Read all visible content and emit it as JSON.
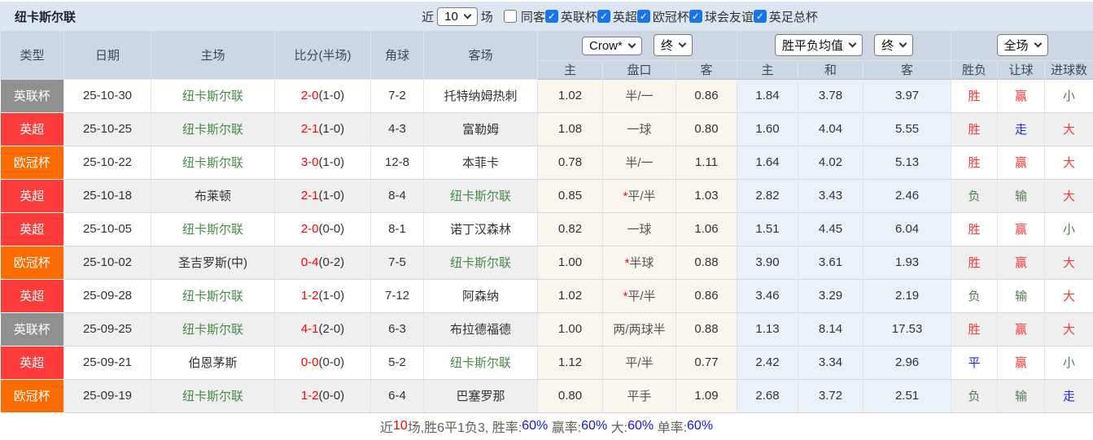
{
  "colors": {
    "bar_bg": "#dce6f0",
    "header_bg": "#cdd7e3",
    "stripe_bg": "#efefef",
    "handicap_col_bg": "#fbf6ed",
    "avg_col_bg": "#e9f2f8",
    "accent_blue_checkbox": "#1a73e8",
    "team_green": "#468c46",
    "score_red": "#ff0000",
    "result_red": "#f03c3c",
    "result_green": "#527d52",
    "result_blue": "#2626e0",
    "league_gray": "#909090",
    "league_red": "#fd3b3b",
    "league_orange": "#fe6c01",
    "summary_blue": "#1414e6",
    "summary_label": "#665e52"
  },
  "filter_bar": {
    "title": "纽卡斯尔联",
    "recent_label": "近",
    "recent_value": "10",
    "games_label": "场",
    "checkboxes": [
      {
        "label": "同客",
        "checked": false
      },
      {
        "label": "英联杯",
        "checked": true
      },
      {
        "label": "英超",
        "checked": true
      },
      {
        "label": "欧冠杯",
        "checked": true
      },
      {
        "label": "球会友谊",
        "checked": true
      },
      {
        "label": "英足总杯",
        "checked": true
      }
    ]
  },
  "table": {
    "main_headers": [
      "类型",
      "日期",
      "主场",
      "比分(半场)",
      "角球",
      "客场"
    ],
    "dropdowns": {
      "handicap_company": "Crow*",
      "handicap_time": "终",
      "odds_avg": "胜平负均值",
      "odds_time": "终",
      "result_scope": "全场"
    },
    "sub_headers": [
      "主",
      "盘口",
      "客",
      "主",
      "和",
      "客",
      "胜负",
      "让球",
      "进球数"
    ],
    "rows": [
      {
        "type": "英联杯",
        "type_color": "gray",
        "date": "25-10-30",
        "home": "纽卡斯尔联",
        "home_highlight": true,
        "score": "2-0",
        "half_score": "(1-0)",
        "corners": "7-2",
        "away": "托特纳姆热刺",
        "away_highlight": false,
        "handicap_home": "1.02",
        "handicap": "半/一",
        "handicap_star": false,
        "handicap_away": "0.86",
        "avg_win": "1.84",
        "avg_draw": "3.78",
        "avg_lose": "3.97",
        "outcome": "胜",
        "outcome_color": "red",
        "handicap_outcome": "赢",
        "handicap_outcome_color": "red",
        "goals_outcome": "小",
        "goals_outcome_color": "green"
      },
      {
        "type": "英超",
        "type_color": "red",
        "date": "25-10-25",
        "home": "纽卡斯尔联",
        "home_highlight": true,
        "score": "2-1",
        "half_score": "(1-0)",
        "corners": "4-3",
        "away": "富勒姆",
        "away_highlight": false,
        "handicap_home": "1.08",
        "handicap": "一球",
        "handicap_star": false,
        "handicap_away": "0.80",
        "avg_win": "1.60",
        "avg_draw": "4.04",
        "avg_lose": "5.55",
        "outcome": "胜",
        "outcome_color": "red",
        "handicap_outcome": "走",
        "handicap_outcome_color": "blue",
        "goals_outcome": "大",
        "goals_outcome_color": "red"
      },
      {
        "type": "欧冠杯",
        "type_color": "orange",
        "date": "25-10-22",
        "home": "纽卡斯尔联",
        "home_highlight": true,
        "score": "3-0",
        "half_score": "(1-0)",
        "corners": "12-8",
        "away": "本菲卡",
        "away_highlight": false,
        "handicap_home": "0.78",
        "handicap": "半/一",
        "handicap_star": false,
        "handicap_away": "1.11",
        "avg_win": "1.64",
        "avg_draw": "4.02",
        "avg_lose": "5.13",
        "outcome": "胜",
        "outcome_color": "red",
        "handicap_outcome": "赢",
        "handicap_outcome_color": "red",
        "goals_outcome": "大",
        "goals_outcome_color": "red"
      },
      {
        "type": "英超",
        "type_color": "red",
        "date": "25-10-18",
        "home": "布莱顿",
        "home_highlight": false,
        "score": "2-1",
        "half_score": "(1-0)",
        "corners": "8-4",
        "away": "纽卡斯尔联",
        "away_highlight": true,
        "handicap_home": "0.85",
        "handicap": "平/半",
        "handicap_star": true,
        "handicap_away": "1.03",
        "avg_win": "2.82",
        "avg_draw": "3.43",
        "avg_lose": "2.46",
        "outcome": "负",
        "outcome_color": "green",
        "handicap_outcome": "输",
        "handicap_outcome_color": "green",
        "goals_outcome": "大",
        "goals_outcome_color": "red"
      },
      {
        "type": "英超",
        "type_color": "red",
        "date": "25-10-05",
        "home": "纽卡斯尔联",
        "home_highlight": true,
        "score": "2-0",
        "half_score": "(0-0)",
        "corners": "8-1",
        "away": "诺丁汉森林",
        "away_highlight": false,
        "handicap_home": "0.82",
        "handicap": "一球",
        "handicap_star": false,
        "handicap_away": "1.06",
        "avg_win": "1.51",
        "avg_draw": "4.45",
        "avg_lose": "6.04",
        "outcome": "胜",
        "outcome_color": "red",
        "handicap_outcome": "赢",
        "handicap_outcome_color": "red",
        "goals_outcome": "小",
        "goals_outcome_color": "green"
      },
      {
        "type": "欧冠杯",
        "type_color": "orange",
        "date": "25-10-02",
        "home": "圣吉罗斯(中)",
        "home_highlight": false,
        "score": "0-4",
        "half_score": "(0-2)",
        "corners": "7-5",
        "away": "纽卡斯尔联",
        "away_highlight": true,
        "handicap_home": "1.00",
        "handicap": "半球",
        "handicap_star": true,
        "handicap_away": "0.88",
        "avg_win": "3.90",
        "avg_draw": "3.61",
        "avg_lose": "1.93",
        "outcome": "胜",
        "outcome_color": "red",
        "handicap_outcome": "赢",
        "handicap_outcome_color": "red",
        "goals_outcome": "大",
        "goals_outcome_color": "red"
      },
      {
        "type": "英超",
        "type_color": "red",
        "date": "25-09-28",
        "home": "纽卡斯尔联",
        "home_highlight": true,
        "score": "1-2",
        "half_score": "(1-0)",
        "corners": "7-12",
        "away": "阿森纳",
        "away_highlight": false,
        "handicap_home": "1.02",
        "handicap": "平/半",
        "handicap_star": true,
        "handicap_away": "0.86",
        "avg_win": "3.46",
        "avg_draw": "3.29",
        "avg_lose": "2.19",
        "outcome": "负",
        "outcome_color": "green",
        "handicap_outcome": "输",
        "handicap_outcome_color": "green",
        "goals_outcome": "大",
        "goals_outcome_color": "red"
      },
      {
        "type": "英联杯",
        "type_color": "gray",
        "date": "25-09-25",
        "home": "纽卡斯尔联",
        "home_highlight": true,
        "score": "4-1",
        "half_score": "(2-0)",
        "corners": "6-3",
        "away": "布拉德福德",
        "away_highlight": false,
        "handicap_home": "1.00",
        "handicap": "两/两球半",
        "handicap_star": false,
        "handicap_away": "0.88",
        "avg_win": "1.13",
        "avg_draw": "8.14",
        "avg_lose": "17.53",
        "outcome": "胜",
        "outcome_color": "red",
        "handicap_outcome": "赢",
        "handicap_outcome_color": "red",
        "goals_outcome": "大",
        "goals_outcome_color": "red"
      },
      {
        "type": "英超",
        "type_color": "red",
        "date": "25-09-21",
        "home": "伯恩茅斯",
        "home_highlight": false,
        "score": "0-0",
        "half_score": "(0-0)",
        "corners": "5-2",
        "away": "纽卡斯尔联",
        "away_highlight": true,
        "handicap_home": "1.12",
        "handicap": "平/半",
        "handicap_star": false,
        "handicap_away": "0.77",
        "avg_win": "2.42",
        "avg_draw": "3.34",
        "avg_lose": "2.96",
        "outcome": "平",
        "outcome_color": "blue",
        "handicap_outcome": "赢",
        "handicap_outcome_color": "red",
        "goals_outcome": "小",
        "goals_outcome_color": "green"
      },
      {
        "type": "欧冠杯",
        "type_color": "orange",
        "date": "25-09-19",
        "home": "纽卡斯尔联",
        "home_highlight": true,
        "score": "1-2",
        "half_score": "(0-0)",
        "corners": "6-4",
        "away": "巴塞罗那",
        "away_highlight": false,
        "handicap_home": "0.80",
        "handicap": "平手",
        "handicap_star": false,
        "handicap_away": "1.09",
        "avg_win": "2.68",
        "avg_draw": "3.72",
        "avg_lose": "2.51",
        "outcome": "负",
        "outcome_color": "green",
        "handicap_outcome": "输",
        "handicap_outcome_color": "green",
        "goals_outcome": "走",
        "goals_outcome_color": "blue"
      }
    ]
  },
  "summary": {
    "parts": [
      {
        "text": "近",
        "style": "label"
      },
      {
        "text": "10",
        "style": "red"
      },
      {
        "text": "场,胜6平1负3, 胜率:",
        "style": "label"
      },
      {
        "text": "60%",
        "style": "blue"
      },
      {
        "text": " 赢率:",
        "style": "label"
      },
      {
        "text": "60%",
        "style": "blue"
      },
      {
        "text": " 大:",
        "style": "label"
      },
      {
        "text": "60%",
        "style": "blue"
      },
      {
        "text": " 单率:",
        "style": "label"
      },
      {
        "text": "60%",
        "style": "blue"
      }
    ]
  }
}
